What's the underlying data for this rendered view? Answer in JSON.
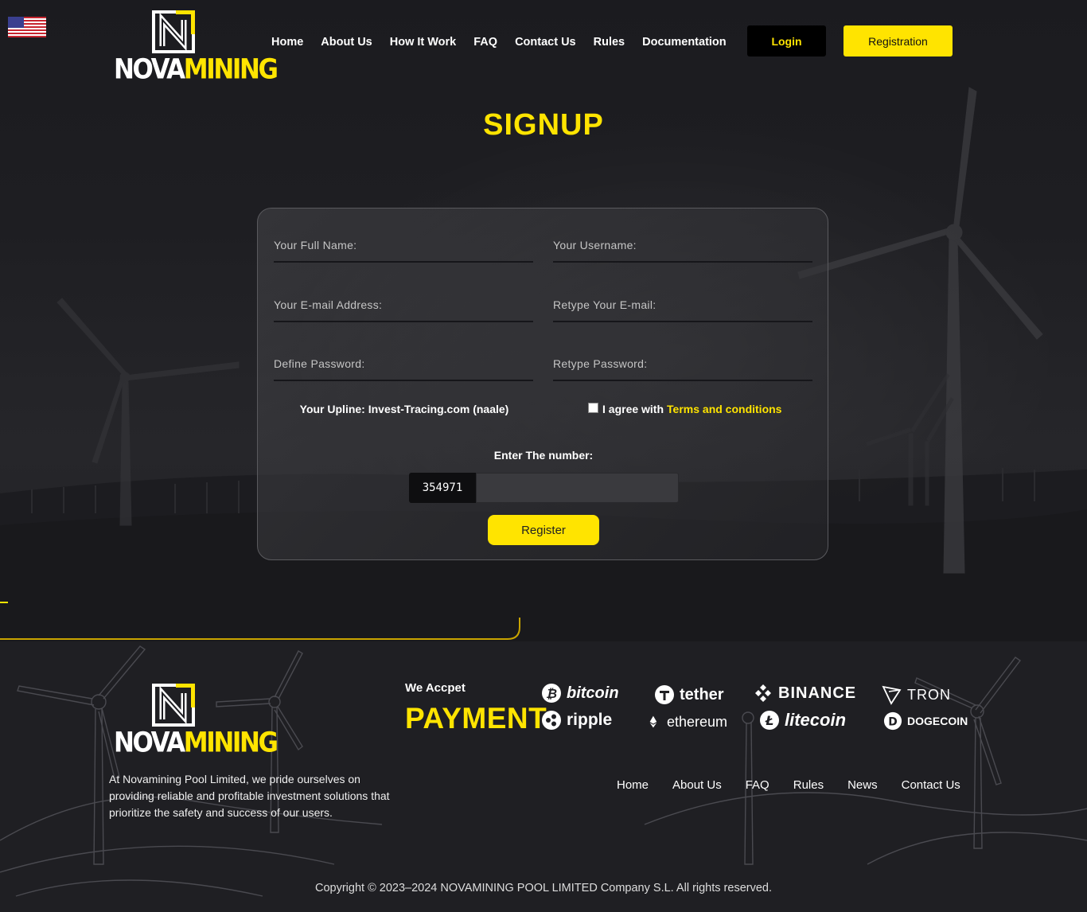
{
  "header": {
    "language_flag": "us-flag-icon",
    "logo": {
      "part1": "NOVA",
      "part2": "MINING"
    },
    "nav": [
      "Home",
      "About Us",
      "How It Work",
      "FAQ",
      "Contact Us",
      "Rules",
      "Documentation"
    ],
    "login_label": "Login",
    "registration_label": "Registration"
  },
  "page": {
    "title": "SIGNUP"
  },
  "form": {
    "full_name_placeholder": "Your Full Name:",
    "username_placeholder": "Your Username:",
    "email_placeholder": "Your E-mail Address:",
    "retype_email_placeholder": "Retype Your E-mail:",
    "password_placeholder": "Define Password:",
    "retype_password_placeholder": "Retype Password:",
    "upline": "Your Upline: Invest-Tracing.com (naale)",
    "agree_text": "I agree with",
    "terms_link": "Terms and conditions",
    "agree_checked": false,
    "captcha_label": "Enter The number:",
    "captcha_code": "354971",
    "captcha_value": "",
    "submit_label": "Register"
  },
  "footer": {
    "logo": {
      "part1": "NOVA",
      "part2": "MINING"
    },
    "description": "At Novamining Pool Limited, we pride ourselves on providing reliable and profitable investment solutions that prioritize the safety and success of our users.",
    "accept_label": "We Accpet",
    "payment_label": "PAYMENT",
    "payment_methods": [
      "bitcoin",
      "tether",
      "BINANCE",
      "TRON",
      "ripple",
      "ethereum",
      "litecoin",
      "DOGECOIN"
    ],
    "nav": [
      "Home",
      "About Us",
      "FAQ",
      "Rules",
      "News",
      "Contact Us"
    ],
    "copyright": "Copyright © 2023–2024 NOVAMINING POOL LIMITED Company S.L. All rights reserved."
  },
  "colors": {
    "accent": "#ffe400",
    "background": "#1f1f23",
    "button_dark": "#000000"
  }
}
